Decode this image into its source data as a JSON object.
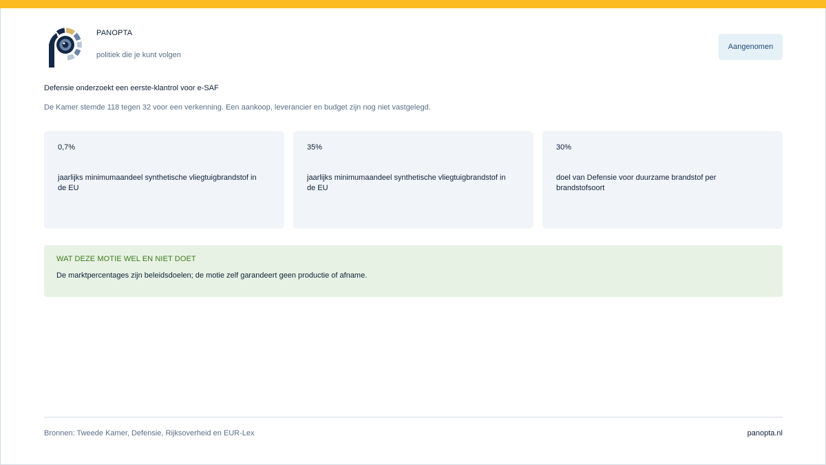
{
  "brand": {
    "name": "PANOPTA",
    "tagline": "politiek die je kunt volgen",
    "logo_icon": "panopta-eye-logo-icon",
    "logo_colors": {
      "dark": "#132846",
      "mid": "#6c84a6",
      "light": "#b7c6d8",
      "accent": "#d9b46a"
    }
  },
  "status": {
    "label": "Aangenomen"
  },
  "headline": "Defensie onderzoekt een eerste-klantrol voor e-SAF",
  "subline": "De Kamer stemde 118 tegen 32 voor een verkenning. Een aankoop, leverancier en budget zijn nog niet vastgelegd.",
  "stats": [
    {
      "value": "0,7%",
      "label": "jaarlijks minimumaandeel synthetische vliegtuigbrandstof in de EU"
    },
    {
      "value": "35%",
      "label": "jaarlijks minimumaandeel synthetische vliegtuigbrandstof in de EU"
    },
    {
      "value": "30%",
      "label": "doel van Defensie voor duurzame brandstof per brandstofsoort"
    }
  ],
  "note": {
    "title": "WAT DEZE MOTIE WEL EN NIET DOET",
    "text": "De marktpercentages zijn beleidsdoelen; de motie zelf garandeert geen productie of afname."
  },
  "footer": {
    "sources": "Bronnen: Tweede Kamer, Defensie, Rijksoverheid en EUR-Lex",
    "site": "panopta.nl"
  },
  "colors": {
    "topbar": "#fbbb21",
    "badge_bg": "#e6f0f7",
    "card_bg": "#f1f4f8",
    "note_bg": "#e7f2e4",
    "note_title": "#3f7a1c"
  }
}
